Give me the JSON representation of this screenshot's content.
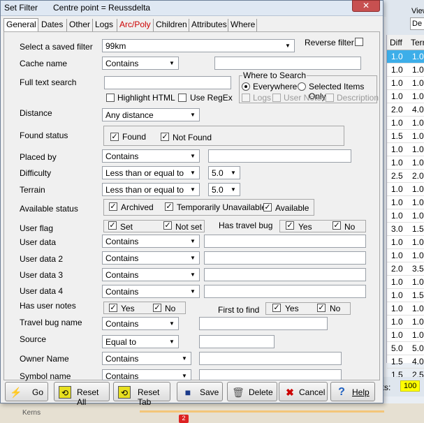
{
  "background": {
    "view_label": "View",
    "view_value": "De",
    "columns": [
      "Diff",
      "Terr"
    ],
    "rows": [
      [
        "1.0",
        "1.0"
      ],
      [
        "1.0",
        "1.0"
      ],
      [
        "1.0",
        "1.0"
      ],
      [
        "1.0",
        "1.0"
      ],
      [
        "2.0",
        "4.0"
      ],
      [
        "1.0",
        "1.0"
      ],
      [
        "1.5",
        "1.0"
      ],
      [
        "1.0",
        "1.0"
      ],
      [
        "1.0",
        "1.0"
      ],
      [
        "2.5",
        "2.0"
      ],
      [
        "1.0",
        "1.0"
      ],
      [
        "1.0",
        "1.0"
      ],
      [
        "1.0",
        "1.0"
      ],
      [
        "3.0",
        "1.5"
      ],
      [
        "1.0",
        "1.0"
      ],
      [
        "1.0",
        "1.0"
      ],
      [
        "2.0",
        "3.5"
      ],
      [
        "1.0",
        "1.0"
      ],
      [
        "1.0",
        "1.5"
      ],
      [
        "1.0",
        "1.0"
      ],
      [
        "1.0",
        "1.0"
      ],
      [
        "1.0",
        "1.0"
      ],
      [
        "5.0",
        "5.0"
      ],
      [
        "1.5",
        "4.0"
      ],
      [
        "1.5",
        "2.5"
      ]
    ],
    "selected_row_index": 0,
    "status_label": "nts:",
    "status_count": "100",
    "map_town": "Kerns",
    "map_marker": "2"
  },
  "dialog": {
    "title": "Set Filter",
    "centre": "Centre point = Reussdelta",
    "close": "✕",
    "tabs": [
      "General",
      "Dates",
      "Other",
      "Logs",
      "Arc/Poly",
      "Children",
      "Attributes",
      "Where"
    ],
    "active_tab": "General",
    "saved_filter": {
      "label": "Select a saved filter",
      "value": "99km"
    },
    "reverse_filter": {
      "label": "Reverse filter",
      "checked": false
    },
    "cache_name": {
      "label": "Cache name",
      "op": "Contains",
      "value": ""
    },
    "full_text": {
      "label": "Full text search",
      "value": "",
      "highlight_html": "Highlight HTML",
      "use_regex": "Use RegEx",
      "where_title": "Where to Search",
      "everywhere": "Everywhere",
      "selected_only": "Selected Items Only",
      "logs": "Logs",
      "user_notes": "User Notes",
      "description": "Description"
    },
    "distance": {
      "label": "Distance",
      "value": "Any distance"
    },
    "found_status": {
      "label": "Found status",
      "found": "Found",
      "not_found": "Not Found"
    },
    "placed_by": {
      "label": "Placed by",
      "op": "Contains",
      "value": ""
    },
    "difficulty": {
      "label": "Difficulty",
      "op": "Less than or equal to",
      "value": "5.0"
    },
    "terrain": {
      "label": "Terrain",
      "op": "Less than or equal to",
      "value": "5.0"
    },
    "available_status": {
      "label": "Available status",
      "archived": "Archived",
      "temp_unavailable": "Temporarily Unavailable",
      "available": "Available"
    },
    "user_flag": {
      "label": "User flag",
      "set": "Set",
      "not_set": "Not set"
    },
    "travel_bug": {
      "label": "Has travel bug",
      "yes": "Yes",
      "no": "No"
    },
    "user_data": [
      {
        "label": "User data",
        "op": "Contains"
      },
      {
        "label": "User data 2",
        "op": "Contains"
      },
      {
        "label": "User data 3",
        "op": "Contains"
      },
      {
        "label": "User data 4",
        "op": "Contains"
      }
    ],
    "user_notes": {
      "label": "Has user notes",
      "yes": "Yes",
      "no": "No"
    },
    "first_to_find": {
      "label": "First to find",
      "yes": "Yes",
      "no": "No"
    },
    "travel_bug_name": {
      "label": "Travel bug name",
      "op": "Contains"
    },
    "source": {
      "label": "Source",
      "op": "Equal to"
    },
    "owner_name": {
      "label": "Owner Name",
      "op": "Contains"
    },
    "symbol_name": {
      "label": "Symbol name",
      "op": "Contains"
    },
    "buttons": {
      "go": "Go",
      "reset_all": "Reset All",
      "reset_tab": "Reset Tab",
      "save": "Save",
      "delete": "Delete",
      "cancel": "Cancel",
      "help": "Help"
    },
    "colors": {
      "selected_row": "#3daee9",
      "count_bg": "#ffff00",
      "arc_tab": "#cc0000"
    }
  }
}
